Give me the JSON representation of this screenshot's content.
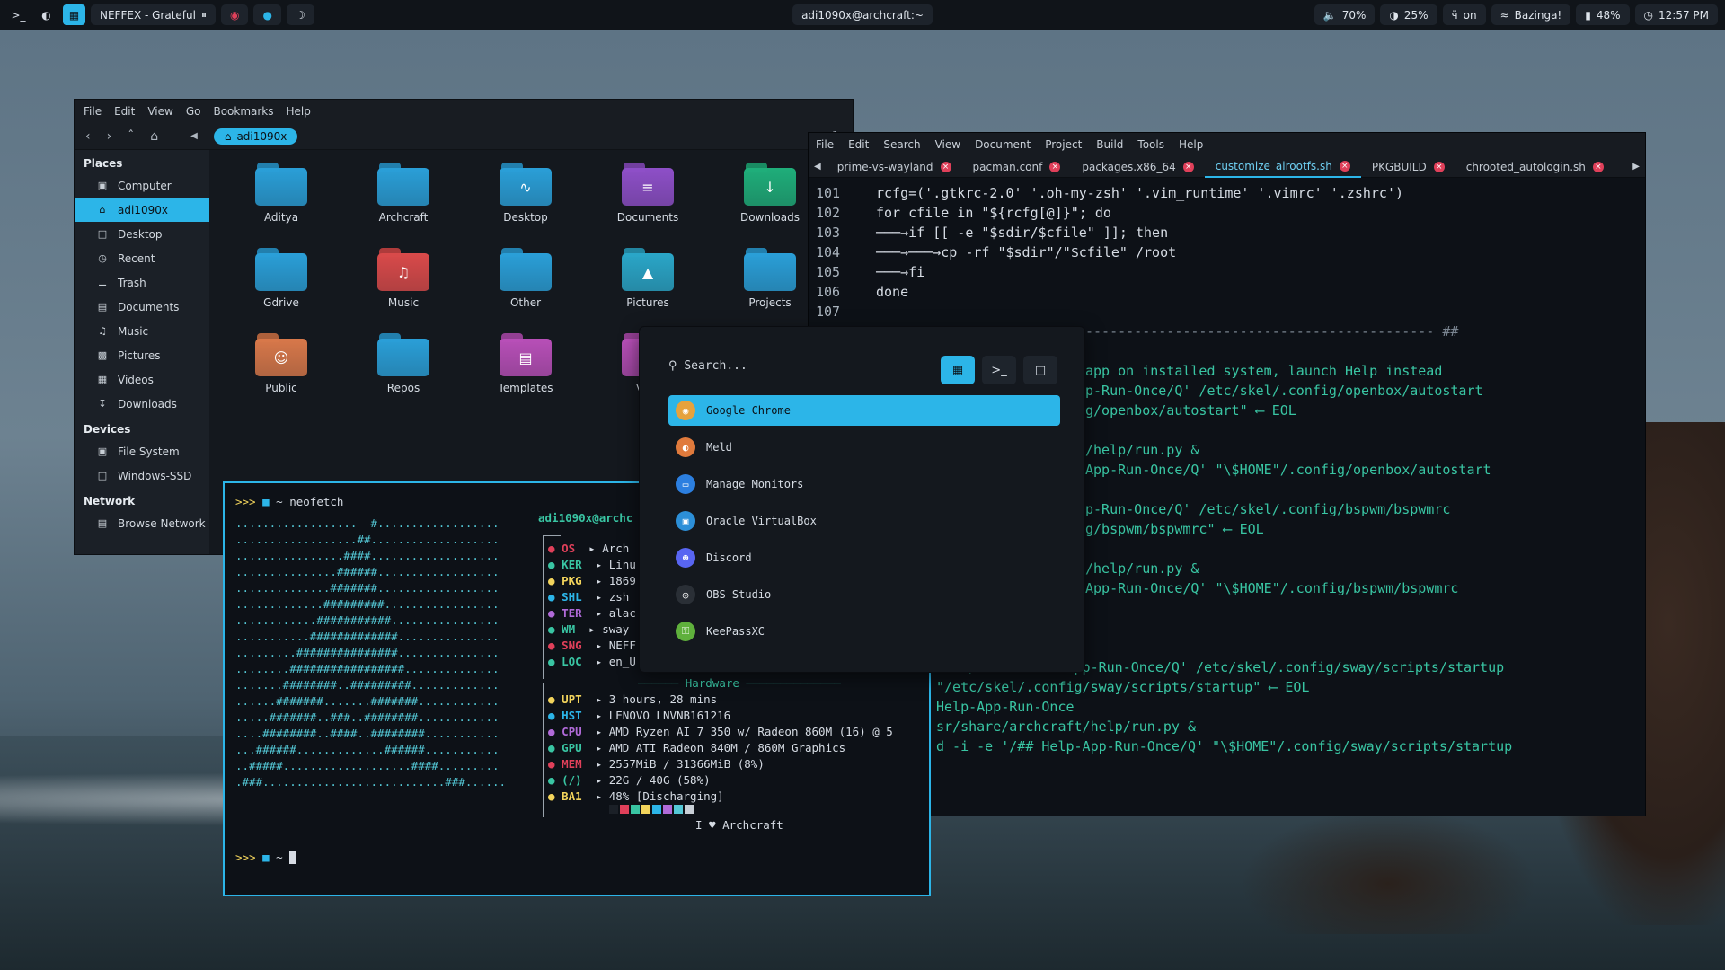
{
  "topbar": {
    "track": "NEFFEX - Grateful",
    "host": "adi1090x@archcraft:~",
    "volume": "70%",
    "brightness": "25%",
    "bluetooth": "on",
    "wifi": "Bazinga!",
    "battery": "48%",
    "time": "12:57 PM"
  },
  "filemanager": {
    "menu": [
      "File",
      "Edit",
      "View",
      "Go",
      "Bookmarks",
      "Help"
    ],
    "location": "adi1090x",
    "sections": {
      "places": "Places",
      "devices": "Devices",
      "network": "Network"
    },
    "places": [
      "Computer",
      "adi1090x",
      "Desktop",
      "Recent",
      "Trash",
      "Documents",
      "Music",
      "Pictures",
      "Videos",
      "Downloads"
    ],
    "devices": [
      "File System",
      "Windows-SSD"
    ],
    "network": [
      "Browse Network"
    ],
    "folders": [
      {
        "name": "Aditya",
        "color": "#2a9fd8"
      },
      {
        "name": "Archcraft",
        "color": "#2a9fd8"
      },
      {
        "name": "Desktop",
        "color": "#2a9fd8"
      },
      {
        "name": "Documents",
        "color": "#8e4fc8"
      },
      {
        "name": "Downloads",
        "color": "#1fae7a"
      },
      {
        "name": "Gdrive",
        "color": "#2a9fd8"
      },
      {
        "name": "Music",
        "color": "#d94a4a"
      },
      {
        "name": "Other",
        "color": "#2a9fd8"
      },
      {
        "name": "Pictures",
        "color": "#2aa6c8"
      },
      {
        "name": "Projects",
        "color": "#2a9fd8"
      },
      {
        "name": "Public",
        "color": "#d8784a"
      },
      {
        "name": "Repos",
        "color": "#2a9fd8"
      },
      {
        "name": "Templates",
        "color": "#b84fb8"
      },
      {
        "name": "Vide",
        "color": "#b84fb8"
      }
    ]
  },
  "editor": {
    "menu": [
      "File",
      "Edit",
      "Search",
      "View",
      "Document",
      "Project",
      "Build",
      "Tools",
      "Help"
    ],
    "tabs": [
      "prime-vs-wayland",
      "pacman.conf",
      "packages.x86_64",
      "customize_airootfs.sh",
      "PKGBUILD",
      "chrooted_autologin.sh"
    ],
    "line_numbers": [
      "101",
      "102",
      "103",
      "104",
      "105",
      "106",
      "107"
    ],
    "lines": [
      "rcfg=('.gtkrc-2.0' '.oh-my-zsh' '.vim_runtime' '.vimrc' '.zshrc')",
      "for cfile in \"${rcfg[@]}\"; do",
      "───→if [[ -e \"$sdir/$cfile\" ]]; then",
      "───→───→cp -rf \"$sdir\"/\"$cfile\" /root",
      "───→fi",
      "done",
      "------------------------------------------- ##",
      "app on installed system, launch Help instead",
      "p-Run-Once/Q' /etc/skel/.config/openbox/autostart",
      "g/openbox/autostart\" ⟵ EOL",
      "/help/run.py &",
      "App-Run-Once/Q' \"\\$HOME\"/.config/openbox/autostart",
      "p-Run-Once/Q' /etc/skel/.config/bspwm/bspwmrc",
      "g/bspwm/bspwmrc\" ⟵ EOL",
      "/help/run.py &",
      "App-Run-Once/Q' \"\\$HOME\"/.config/bspwm/bspwmrc",
      "-e '/## Welcome-App-Run-Once/Q' /etc/skel/.config/sway/scripts/startup",
      "\"/etc/skel/.config/sway/scripts/startup\" ⟵ EOL",
      "Help-App-Run-Once",
      "sr/share/archcraft/help/run.py &",
      "d -i -e '/## Help-App-Run-Once/Q' \"\\$HOME\"/.config/sway/scripts/startup"
    ]
  },
  "terminal": {
    "prompt": ">>>",
    "cmd": "~ neofetch",
    "user": "adi1090x@archc",
    "info": [
      {
        "k": "OS",
        "v": "Arch",
        "c": "#e0405a"
      },
      {
        "k": "KER",
        "v": "Linu",
        "c": "#39c5a3"
      },
      {
        "k": "PKG",
        "v": "1869",
        "c": "#f2d45c"
      },
      {
        "k": "SHL",
        "v": "zsh",
        "c": "#2cb5e8"
      },
      {
        "k": "TER",
        "v": "alac",
        "c": "#b06ad8"
      },
      {
        "k": "WM",
        "v": "sway",
        "c": "#39c5a3"
      },
      {
        "k": "SNG",
        "v": "NEFF",
        "c": "#e0405a"
      },
      {
        "k": "LOC",
        "v": "en_U",
        "c": "#39c5a3"
      }
    ],
    "hw_title": "Hardware",
    "hw": [
      {
        "k": "UPT",
        "v": "3 hours, 28 mins",
        "c": "#f2d45c"
      },
      {
        "k": "HST",
        "v": "LENOVO LNVNB161216",
        "c": "#2cb5e8"
      },
      {
        "k": "CPU",
        "v": "AMD Ryzen AI 7 350 w/ Radeon 860M (16) @ 5",
        "c": "#b06ad8"
      },
      {
        "k": "GPU",
        "v": "AMD ATI Radeon 840M / 860M Graphics",
        "c": "#39c5a3"
      },
      {
        "k": "MEM",
        "v": "2557MiB / 31366MiB (8%)",
        "c": "#e0405a"
      },
      {
        "k": "(/)",
        "v": "22G / 40G (58%)",
        "c": "#39c5a3"
      },
      {
        "k": "BA1",
        "v": "48% [Discharging]",
        "c": "#f2d45c"
      }
    ],
    "footer": "I ♥ Archcraft",
    "palette": [
      "#1b2027",
      "#e0405a",
      "#39c5a3",
      "#f2d45c",
      "#2cb5e8",
      "#b06ad8",
      "#54c8d6",
      "#c8cfd6"
    ],
    "art": [
      "..................  #..................",
      "..................##...................",
      "................####...................",
      "...............######..................",
      "..............#######..................",
      ".............#########.................",
      "............###########................",
      "...........#############...............",
      ".........###############...............",
      "........#################..............",
      ".......########..#########.............",
      "......#######.......#######............",
      ".....#######..###..########............",
      "....########..####..########...........",
      "...######.............######...........",
      "..#####...................####.........",
      ".###...........................###......"
    ]
  },
  "launcher": {
    "placeholder": "Search...",
    "apps": [
      {
        "name": "Google Chrome",
        "icon": "chrome-icon",
        "color": "#e6a23c"
      },
      {
        "name": "Meld",
        "icon": "meld-icon",
        "color": "#e07a3c"
      },
      {
        "name": "Manage Monitors",
        "icon": "monitor-icon",
        "color": "#2c7fe0"
      },
      {
        "name": "Oracle VirtualBox",
        "icon": "virtualbox-icon",
        "color": "#2c8fd8"
      },
      {
        "name": "Discord",
        "icon": "discord-icon",
        "color": "#5865f2"
      },
      {
        "name": "OBS Studio",
        "icon": "obs-icon",
        "color": "#2a2f36"
      },
      {
        "name": "KeePassXC",
        "icon": "keepass-icon",
        "color": "#5fb03c"
      }
    ]
  }
}
